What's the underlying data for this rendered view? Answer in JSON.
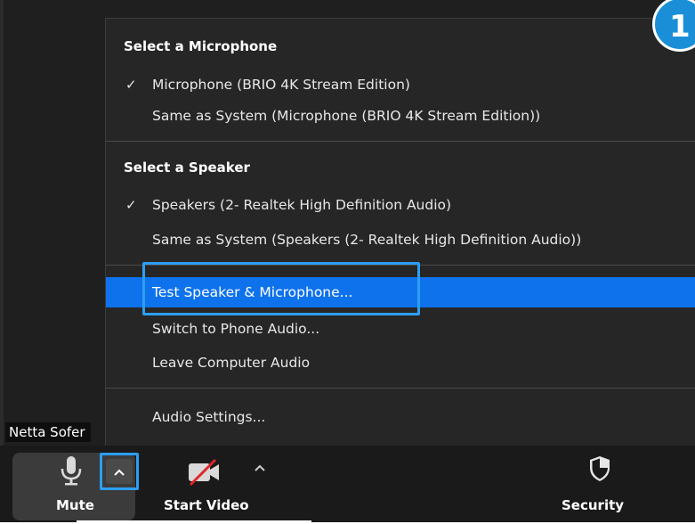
{
  "step_badge": "1",
  "participant": {
    "name": "Netta Sofer"
  },
  "audio_menu": {
    "microphone_heading": "Select a Microphone",
    "microphone_options": [
      {
        "label": "Microphone (BRIO 4K Stream Edition)",
        "checked": true
      },
      {
        "label": "Same as System (Microphone (BRIO 4K Stream Edition))",
        "checked": false
      }
    ],
    "speaker_heading": "Select a Speaker",
    "speaker_options": [
      {
        "label": "Speakers (2- Realtek High Definition Audio)",
        "checked": true
      },
      {
        "label": "Same as System (Speakers (2- Realtek High Definition Audio))",
        "checked": false
      }
    ],
    "actions": [
      {
        "label": "Test Speaker & Microphone...",
        "highlighted": true
      },
      {
        "label": "Switch to Phone Audio...",
        "highlighted": false
      },
      {
        "label": "Leave Computer Audio",
        "highlighted": false
      }
    ],
    "settings_label": "Audio Settings...",
    "check_glyph": "✓"
  },
  "toolbar": {
    "mute_label": "Mute",
    "start_video_label": "Start Video",
    "security_label": "Security",
    "caret_glyph": "^"
  },
  "colors": {
    "highlight": "#0e72ed",
    "annotation": "#2d9ef3",
    "badge": "#1a8fd8",
    "muted_video_slash": "#e0252b"
  },
  "icons": [
    "microphone-icon",
    "video-off-icon",
    "shield-icon",
    "chevron-up-icon",
    "checkmark-icon"
  ]
}
